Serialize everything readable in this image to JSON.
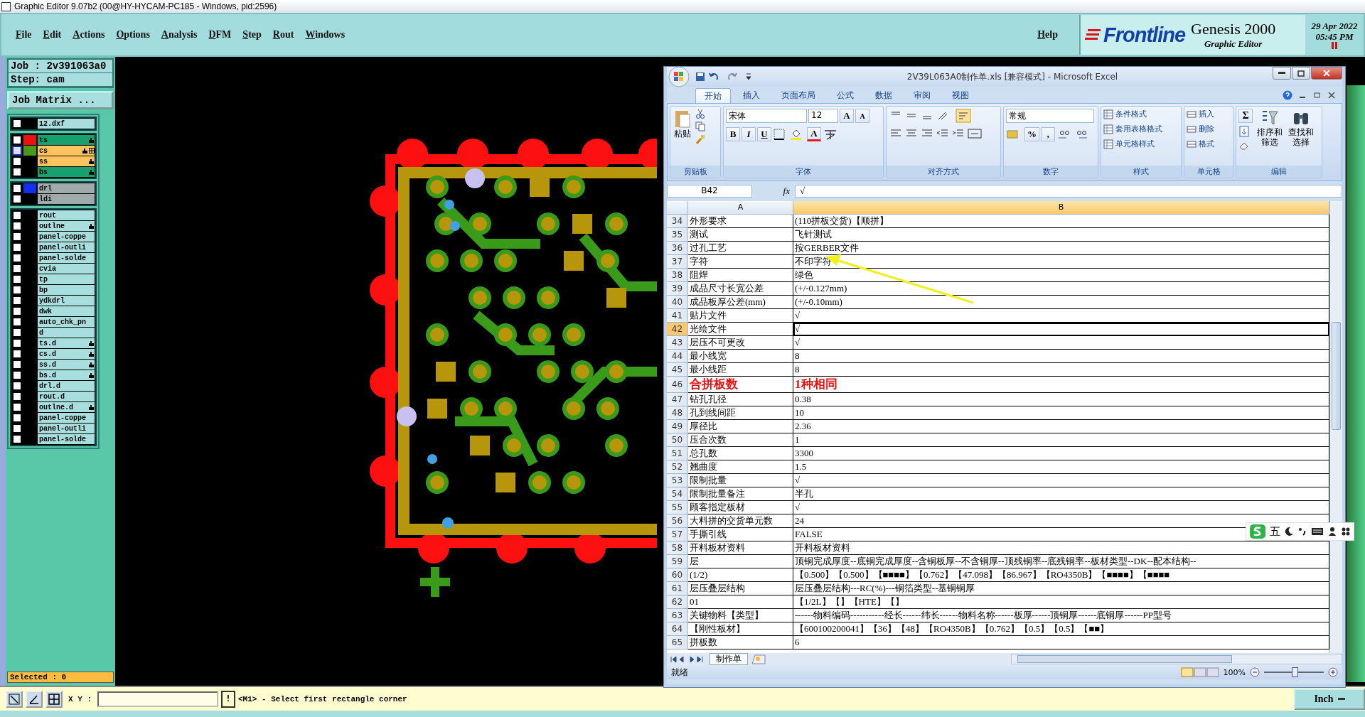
{
  "window": {
    "title": "Graphic Editor 9.07b2 (00@HY-HYCAM-PC185 - Windows, pid:2596)"
  },
  "menu": [
    "File",
    "Edit",
    "Actions",
    "Options",
    "Analysis",
    "DFM",
    "Step",
    "Rout",
    "Windows"
  ],
  "help": "Help",
  "brand": {
    "logo": "Frontline",
    "product": "Genesis 2000",
    "subtitle": "Graphic Editor",
    "date": "29 Apr 2022",
    "time": "05:45 PM"
  },
  "job": {
    "job": "Job : 2v391063a0",
    "step": "Step: cam",
    "matrix_button": "Job Matrix ..."
  },
  "layer_groups": [
    [
      {
        "name": "12.dxf",
        "kind": "misc",
        "pointer": false,
        "extra_icon": false,
        "selected": false
      }
    ],
    [
      {
        "name": "ts",
        "kind": "silk",
        "color": "#ee1111",
        "pointer": true,
        "extra_icon": false,
        "selected": false
      },
      {
        "name": "cs",
        "kind": "copper",
        "color": "#4a9a1a",
        "pointer": true,
        "extra_icon": true,
        "selected": true
      },
      {
        "name": "ss",
        "kind": "copper",
        "pointer": true,
        "extra_icon": false,
        "selected": false
      },
      {
        "name": "bs",
        "kind": "silk",
        "pointer": true,
        "extra_icon": false,
        "selected": false
      }
    ],
    [
      {
        "name": "drl",
        "kind": "drill",
        "color": "#1030ee",
        "pointer": false,
        "extra_icon": false,
        "selected": false
      },
      {
        "name": "ldi",
        "kind": "drill",
        "pointer": false,
        "extra_icon": false,
        "selected": false
      }
    ],
    [
      {
        "name": "rout",
        "kind": "misc",
        "pointer": false,
        "extra_icon": false,
        "selected": false
      },
      {
        "name": "outlne",
        "kind": "misc",
        "pointer": true,
        "extra_icon": false,
        "selected": false
      },
      {
        "name": "panel-coppe",
        "kind": "misc",
        "pointer": false,
        "extra_icon": false,
        "selected": false
      },
      {
        "name": "panel-outli",
        "kind": "misc",
        "pointer": false,
        "extra_icon": false,
        "selected": false
      },
      {
        "name": "panel-solde",
        "kind": "misc",
        "pointer": false,
        "extra_icon": false,
        "selected": false
      },
      {
        "name": "cvia",
        "kind": "misc",
        "pointer": false,
        "extra_icon": false,
        "selected": false
      },
      {
        "name": "tp",
        "kind": "misc",
        "pointer": false,
        "extra_icon": false,
        "selected": false
      },
      {
        "name": "bp",
        "kind": "misc",
        "pointer": false,
        "extra_icon": false,
        "selected": false
      },
      {
        "name": "ydkdrl",
        "kind": "misc",
        "pointer": false,
        "extra_icon": false,
        "selected": false
      },
      {
        "name": "dwk",
        "kind": "misc",
        "pointer": false,
        "extra_icon": false,
        "selected": false
      },
      {
        "name": "auto_chk_pn",
        "kind": "misc",
        "pointer": false,
        "extra_icon": false,
        "selected": false
      },
      {
        "name": "d",
        "kind": "misc",
        "pointer": false,
        "extra_icon": false,
        "selected": false
      },
      {
        "name": "ts.d",
        "kind": "misc",
        "pointer": true,
        "extra_icon": false,
        "selected": false
      },
      {
        "name": "cs.d",
        "kind": "misc",
        "pointer": true,
        "extra_icon": false,
        "selected": false
      },
      {
        "name": "ss.d",
        "kind": "misc",
        "pointer": true,
        "extra_icon": false,
        "selected": false
      },
      {
        "name": "bs.d",
        "kind": "misc",
        "pointer": true,
        "extra_icon": false,
        "selected": false
      },
      {
        "name": "drl.d",
        "kind": "misc",
        "pointer": false,
        "extra_icon": false,
        "selected": false
      },
      {
        "name": "rout.d",
        "kind": "misc",
        "pointer": false,
        "extra_icon": false,
        "selected": false
      },
      {
        "name": "outlne.d",
        "kind": "misc",
        "pointer": true,
        "extra_icon": false,
        "selected": false
      },
      {
        "name": "panel-coppe",
        "kind": "misc",
        "pointer": false,
        "extra_icon": false,
        "selected": false
      },
      {
        "name": "panel-outli",
        "kind": "misc",
        "pointer": false,
        "extra_icon": false,
        "selected": false
      },
      {
        "name": "panel-solde",
        "kind": "misc",
        "pointer": false,
        "extra_icon": false,
        "selected": false
      }
    ]
  ],
  "selected_count": "Selected : 0",
  "excel": {
    "title": "2V39L063A0制作单.xls  [兼容模式] - Microsoft Excel",
    "tabs": [
      {
        "label": "开始",
        "selected": true
      },
      {
        "label": "插入",
        "selected": false
      },
      {
        "label": "页面布局",
        "selected": false
      },
      {
        "label": "公式",
        "selected": false
      },
      {
        "label": "数据",
        "selected": false
      },
      {
        "label": "审阅",
        "selected": false
      },
      {
        "label": "视图",
        "selected": false
      }
    ],
    "paste": "粘贴",
    "font_name": "宋体",
    "font_size": "12",
    "grow": "A",
    "shrink": "A",
    "font_buttons": [
      "B",
      "I",
      "U"
    ],
    "font_color": "A",
    "number_format": "常规",
    "percent": "%",
    "comma": ",",
    "styles": [
      "条件格式",
      "套用表格格式",
      "单元格样式"
    ],
    "cells": [
      "插入",
      "删除",
      "格式"
    ],
    "sigma": "Σ",
    "sort": [
      "排序和",
      "筛选"
    ],
    "find": [
      "查找和",
      "选择"
    ],
    "group_labels": [
      "剪贴板",
      "字体",
      "对齐方式",
      "数字",
      "样式",
      "单元格",
      "编辑"
    ],
    "name_box": "B42",
    "fx": "fx",
    "formula": "√",
    "columns": [
      "A",
      "B"
    ],
    "rows": [
      {
        "num": "34",
        "a": "外形要求",
        "b": "(110拼板交货)【顺拼】",
        "kind": "normal",
        "selected": false
      },
      {
        "num": "35",
        "a": "测试",
        "b": "飞针测试",
        "kind": "normal",
        "selected": false
      },
      {
        "num": "36",
        "a": "过孔工艺",
        "b": "按GERBER文件",
        "kind": "normal",
        "selected": false
      },
      {
        "num": "37",
        "a": "字符",
        "b": "不印字符",
        "kind": "normal",
        "selected": false
      },
      {
        "num": "38",
        "a": "阻焊",
        "b": "绿色",
        "kind": "normal",
        "selected": false
      },
      {
        "num": "39",
        "a": "成品尺寸长宽公差",
        "b": "(+/-0.127mm)",
        "kind": "normal",
        "selected": false
      },
      {
        "num": "40",
        "a": "成品板厚公差(mm)",
        "b": "(+/-0.10mm)",
        "kind": "normal",
        "selected": false
      },
      {
        "num": "41",
        "a": "贴片文件",
        "b": "√",
        "kind": "normal",
        "selected": false
      },
      {
        "num": "42",
        "a": "光绘文件",
        "b": "√",
        "kind": "normal",
        "selected": true
      },
      {
        "num": "43",
        "a": "层压不可更改",
        "b": "√",
        "kind": "normal",
        "selected": false
      },
      {
        "num": "44",
        "a": "最小线宽",
        "b": "8",
        "kind": "normal",
        "selected": false
      },
      {
        "num": "45",
        "a": "最小线距",
        "b": "8",
        "kind": "normal",
        "selected": false
      },
      {
        "num": "46",
        "a": "合拼板数",
        "b": "1种相同",
        "kind": "emphasis",
        "selected": false
      },
      {
        "num": "47",
        "a": "钻孔孔径",
        "b": "0.38",
        "kind": "normal",
        "selected": false
      },
      {
        "num": "48",
        "a": "孔到线间距",
        "b": "10",
        "kind": "normal",
        "selected": false
      },
      {
        "num": "49",
        "a": "厚径比",
        "b": "2.36",
        "kind": "normal",
        "selected": false
      },
      {
        "num": "50",
        "a": "压合次数",
        "b": "1",
        "kind": "normal",
        "selected": false
      },
      {
        "num": "51",
        "a": "总孔数",
        "b": "3300",
        "kind": "normal",
        "selected": false
      },
      {
        "num": "52",
        "a": "翘曲度",
        "b": "1.5",
        "kind": "normal",
        "selected": false
      },
      {
        "num": "53",
        "a": "限制批量",
        "b": "√",
        "kind": "normal",
        "selected": false
      },
      {
        "num": "54",
        "a": "限制批量备注",
        "b": "半孔",
        "kind": "normal",
        "selected": false
      },
      {
        "num": "55",
        "a": "顾客指定板材",
        "b": "√",
        "kind": "normal",
        "selected": false
      },
      {
        "num": "56",
        "a": "大料拼的交货单元数",
        "b": "24",
        "kind": "normal",
        "selected": false
      },
      {
        "num": "57",
        "a": "手撕引线",
        "b": "FALSE",
        "kind": "normal",
        "selected": false
      },
      {
        "num": "58",
        "a": "开料板材资料",
        "b": "开料板材资料",
        "kind": "normal",
        "selected": false
      },
      {
        "num": "59",
        "a": "层",
        "b": "顶铜完成厚度--底铜完成厚度--含铜板厚--不含铜厚--顶残铜率--底残铜率--板材类型--DK--配本结构--",
        "kind": "normal",
        "selected": false
      },
      {
        "num": "60",
        "a": "(1/2)",
        "b": "【0.500】【0.500】【■■■■】【0.762】【47.098】【86.967】【RO4350B】【■■■■】【■■■■",
        "kind": "normal",
        "selected": false
      },
      {
        "num": "61",
        "a": "层压叠层结构",
        "b": "层压叠层结构---RC(%)---铜箔类型--基铜铜厚",
        "kind": "normal",
        "selected": false
      },
      {
        "num": "62",
        "a": "01",
        "b": "【1/2L】【】【HTE】【】",
        "kind": "normal",
        "selected": false
      },
      {
        "num": "63",
        "a": "关键物料【类型】",
        "b": "------物料编码-----------经长------纬长------物料名称------板厚------顶铜厚------底铜厚------PP型号",
        "kind": "normal",
        "selected": false
      },
      {
        "num": "64",
        "a": "【刚性板材】",
        "b": "【600100200041】【36】【48】【RO4350B】【0.762】【0.5】【0.5】【■■】",
        "kind": "normal",
        "selected": false
      },
      {
        "num": "65",
        "a": "拼板数",
        "b": "6",
        "kind": "normal",
        "selected": false
      }
    ],
    "sheet_tab": "制作单",
    "status": "就绪",
    "zoom": "100%",
    "zoom_slider": {
      "level": 0.5
    }
  },
  "ime": "五",
  "bottom": {
    "xy_label": "X Y :",
    "alert": "!",
    "prompt": "<M1> - Select first rectangle corner",
    "units": "Inch"
  }
}
